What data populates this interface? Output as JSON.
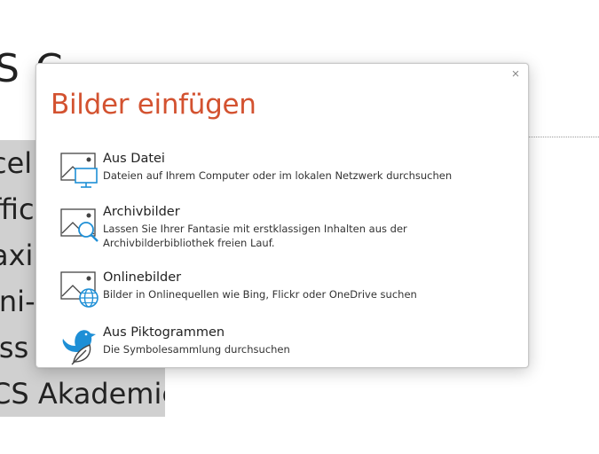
{
  "document": {
    "title_fragment": "S C",
    "list_items": [
      "cel",
      "ffic",
      "axi",
      "ini-",
      "iss",
      "CS Akademie"
    ]
  },
  "dialog": {
    "title": "Bilder einfügen",
    "close_glyph": "×",
    "options": [
      {
        "title": "Aus Datei",
        "description": "Dateien auf Ihrem Computer oder im lokalen Netzwerk durchsuchen",
        "icon": "picture-monitor-icon"
      },
      {
        "title": "Archivbilder",
        "description": "Lassen Sie Ihrer Fantasie mit erstklassigen Inhalten aus der Archivbilderbibliothek freien Lauf.",
        "icon": "picture-search-icon"
      },
      {
        "title": "Onlinebilder",
        "description": "Bilder in Onlinequellen wie Bing, Flickr oder OneDrive suchen",
        "icon": "picture-globe-icon"
      },
      {
        "title": "Aus Piktogrammen",
        "description": "Die Symbolesammlung durchsuchen",
        "icon": "bird-leaf-icon"
      }
    ]
  },
  "colors": {
    "title_accent": "#d35230",
    "icon_blue": "#1e8fd6",
    "highlight": "#d0d0d0"
  }
}
